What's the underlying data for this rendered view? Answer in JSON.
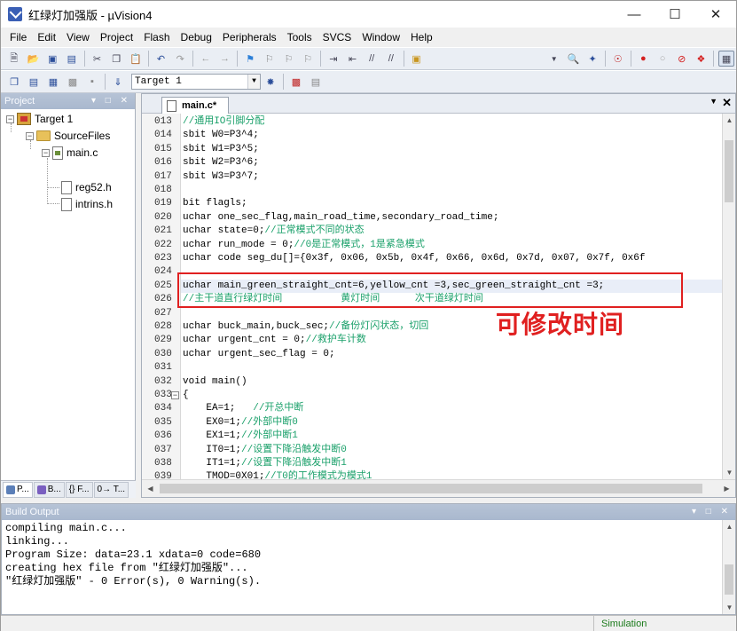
{
  "window": {
    "title": "红绿灯加强版 - µVision4"
  },
  "menu": [
    "File",
    "Edit",
    "View",
    "Project",
    "Flash",
    "Debug",
    "Peripherals",
    "Tools",
    "SVCS",
    "Window",
    "Help"
  ],
  "toolbar": {
    "target": "Target 1"
  },
  "project_panel": {
    "title": "Project",
    "tree": {
      "target": "Target 1",
      "group": "SourceFiles",
      "file": "main.c",
      "includes": [
        "reg52.h",
        "intrins.h"
      ]
    },
    "tabs": [
      "P...",
      "B...",
      "{} F...",
      "0→ T..."
    ]
  },
  "editor": {
    "tab_label": "main.c*",
    "lines": [
      {
        "n": "013",
        "segs": [
          {
            "t": "//通用IO引脚分配",
            "c": "cm"
          }
        ]
      },
      {
        "n": "014",
        "segs": [
          {
            "t": "sbit W0=P3^4;",
            "c": ""
          }
        ]
      },
      {
        "n": "015",
        "segs": [
          {
            "t": "sbit W1=P3^5;",
            "c": ""
          }
        ]
      },
      {
        "n": "016",
        "segs": [
          {
            "t": "sbit W2=P3^6;",
            "c": ""
          }
        ]
      },
      {
        "n": "017",
        "segs": [
          {
            "t": "sbit W3=P3^7;",
            "c": ""
          }
        ]
      },
      {
        "n": "018",
        "segs": [
          {
            "t": "",
            "c": ""
          }
        ]
      },
      {
        "n": "019",
        "segs": [
          {
            "t": "bit flagls;",
            "c": ""
          }
        ]
      },
      {
        "n": "020",
        "segs": [
          {
            "t": "uchar one_sec_flag,main_road_time,secondary_road_time;",
            "c": ""
          }
        ]
      },
      {
        "n": "021",
        "segs": [
          {
            "t": "uchar state=0;",
            "c": ""
          },
          {
            "t": "//正常模式不同的状态",
            "c": "cm"
          }
        ]
      },
      {
        "n": "022",
        "segs": [
          {
            "t": "uchar run_mode = 0;",
            "c": ""
          },
          {
            "t": "//0是正常模式，1是紧急模式",
            "c": "cm"
          }
        ]
      },
      {
        "n": "023",
        "segs": [
          {
            "t": "uchar code seg_du[]={0x3f, 0x06, 0x5b, 0x4f, 0x66, 0x6d, 0x7d, 0x07, 0x7f, 0x6f",
            "c": ""
          }
        ]
      },
      {
        "n": "024",
        "segs": [
          {
            "t": "",
            "c": ""
          }
        ]
      },
      {
        "n": "025",
        "segs": [
          {
            "t": "uchar main_green_straight_cnt=6,yellow_cnt =3,sec_green_straight_cnt =3;",
            "c": ""
          }
        ],
        "current": true
      },
      {
        "n": "026",
        "segs": [
          {
            "t": "//主干道直行绿灯时间          黄灯时间      次干道绿灯时间",
            "c": "cm"
          }
        ]
      },
      {
        "n": "027",
        "segs": [
          {
            "t": "",
            "c": ""
          }
        ]
      },
      {
        "n": "028",
        "segs": [
          {
            "t": "uchar buck_main,buck_sec;",
            "c": ""
          },
          {
            "t": "//备份灯闪状态，切回",
            "c": "cm"
          }
        ]
      },
      {
        "n": "029",
        "segs": [
          {
            "t": "uchar urgent_cnt = 0;",
            "c": ""
          },
          {
            "t": "//救护车计数",
            "c": "cm"
          }
        ]
      },
      {
        "n": "030",
        "segs": [
          {
            "t": "uchar urgent_sec_flag = 0;",
            "c": ""
          }
        ]
      },
      {
        "n": "031",
        "segs": [
          {
            "t": "",
            "c": ""
          }
        ]
      },
      {
        "n": "032",
        "segs": [
          {
            "t": "void main()",
            "c": ""
          }
        ]
      },
      {
        "n": "033",
        "segs": [
          {
            "t": "{",
            "c": ""
          }
        ],
        "fold": true
      },
      {
        "n": "034",
        "segs": [
          {
            "t": "    EA=1;   ",
            "c": ""
          },
          {
            "t": "//开总中断",
            "c": "cm"
          }
        ]
      },
      {
        "n": "035",
        "segs": [
          {
            "t": "    EX0=1;",
            "c": ""
          },
          {
            "t": "//外部中断0",
            "c": "cm"
          }
        ]
      },
      {
        "n": "036",
        "segs": [
          {
            "t": "    EX1=1;",
            "c": ""
          },
          {
            "t": "//外部中断1",
            "c": "cm"
          }
        ]
      },
      {
        "n": "037",
        "segs": [
          {
            "t": "    IT0=1;",
            "c": ""
          },
          {
            "t": "//设置下降沿触发中断0",
            "c": "cm"
          }
        ]
      },
      {
        "n": "038",
        "segs": [
          {
            "t": "    IT1=1;",
            "c": ""
          },
          {
            "t": "//设置下降沿触发中断1",
            "c": "cm"
          }
        ]
      },
      {
        "n": "039",
        "segs": [
          {
            "t": "    TMOD=0X01;",
            "c": ""
          },
          {
            "t": "//T0的工作模式为模式1",
            "c": "cm"
          }
        ]
      }
    ],
    "annotation": "可修改时间"
  },
  "build_output": {
    "title": "Build Output",
    "lines": [
      "compiling main.c...",
      "linking...",
      "Program Size: data=23.1 xdata=0 code=680",
      "creating hex file from \"红绿灯加强版\"...",
      "\"红绿灯加强版\" - 0 Error(s), 0 Warning(s)."
    ]
  },
  "status": {
    "mode": "Simulation"
  }
}
